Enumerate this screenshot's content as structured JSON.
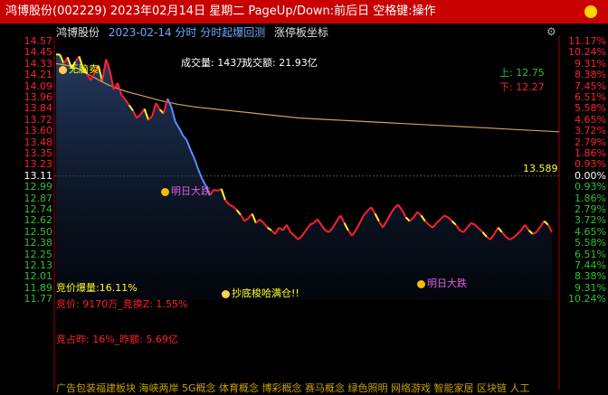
{
  "window": {
    "title": "鸿博股份(002229) 2023年02月14日 星期二 PageUp/Down:前后日 空格键:操作"
  },
  "header": {
    "stock_name": "鸿博股份",
    "info": "2023-02-14 分时 分时起爆回测",
    "mode": "涨停板坐标",
    "settings_icon": "gear-icon"
  },
  "summary": {
    "volume_label": "成交量: 143万",
    "amount_label": "成交额: 21.93亿"
  },
  "range": {
    "up_label": "上: 12.75",
    "down_label": "下: 12.27"
  },
  "left_axis": [
    "14.57",
    "14.45",
    "14.33",
    "14.21",
    "14.09",
    "13.96",
    "13.84",
    "13.72",
    "13.60",
    "13.48",
    "13.35",
    "13.23",
    "13.11",
    "12.99",
    "12.87",
    "12.74",
    "12.62",
    "12.50",
    "12.38",
    "12.25",
    "12.13",
    "12.01",
    "11.89",
    "11.77"
  ],
  "right_axis": [
    "11.17%",
    "10.24%",
    "9.31%",
    "8.38%",
    "7.45%",
    "6.51%",
    "5.58%",
    "4.65%",
    "3.72%",
    "2.79%",
    "1.86%",
    "0.93%",
    "0.00%",
    "0.93%",
    "1.86%",
    "2.79%",
    "3.72%",
    "4.65%",
    "5.58%",
    "6.51%",
    "7.44%",
    "8.38%",
    "9.31%",
    "10.24%"
  ],
  "annotations": {
    "sell_signal": "无脑卖",
    "drop_signal_1": "明日大跌",
    "bottom_signal": "抄底梭哈满仓!!",
    "drop_signal_2": "明日大跌",
    "avg_value": "13.589"
  },
  "stats": {
    "bid_volume": "竞价爆量:16.11%",
    "bid_price": "竞价: 9170万_竞换Z: 1.55%",
    "bid_ratio": "竞占昨: 16%_昨额: 5.69亿"
  },
  "footer": {
    "concepts": "广告包装福建板块 海峡两岸 5G概念 体育概念 博彩概念 赛马概念 绿色照明 网络游戏 智能家居 区块链 人工"
  },
  "colors": {
    "title_bar": "#c80000",
    "rise": "#ff2030",
    "fall": "#30c030",
    "flat": "#ffffff",
    "yellow_line": "#ffff20",
    "avg_line": "#d0a060",
    "blue_line": "#5a8cff",
    "magenta": "#e060e0"
  },
  "chart_data": {
    "type": "line",
    "title": "",
    "xlabel": "",
    "ylabel": "",
    "ylim": [
      11.77,
      14.57
    ],
    "prev_close": 13.11,
    "series": [
      {
        "kind": "price",
        "values": [
          14.43,
          14.43,
          14.33,
          14.4,
          14.28,
          14.35,
          14.41,
          14.28,
          14.22,
          14.15,
          14.23,
          14.31,
          14.14,
          14.38,
          14.25,
          14.05,
          14.12,
          13.99,
          13.94,
          13.88,
          13.82,
          13.74,
          13.78,
          13.84,
          13.72,
          13.76,
          13.9,
          13.83,
          13.79,
          13.95,
          13.86,
          13.7,
          13.63,
          13.55,
          13.5,
          13.39,
          13.3,
          13.18,
          13.08,
          13.0,
          12.9,
          12.96,
          12.95,
          12.97,
          12.85,
          12.8,
          12.78,
          12.74,
          12.69,
          12.62,
          12.65,
          12.7,
          12.6,
          12.64,
          12.6,
          12.55,
          12.52,
          12.48,
          12.55,
          12.52,
          12.58,
          12.5,
          12.46,
          12.42,
          12.46,
          12.52,
          12.58,
          12.6,
          12.64,
          12.58,
          12.52,
          12.5,
          12.55,
          12.62,
          12.68,
          12.6,
          12.52,
          12.46,
          12.52,
          12.6,
          12.68,
          12.73,
          12.77,
          12.7,
          12.62,
          12.55,
          12.62,
          12.7,
          12.76,
          12.8,
          12.74,
          12.66,
          12.62,
          12.66,
          12.72,
          12.68,
          12.62,
          12.58,
          12.55,
          12.6,
          12.64,
          12.68,
          12.66,
          12.62,
          12.58,
          12.52,
          12.5,
          12.55,
          12.6,
          12.58,
          12.54,
          12.5,
          12.45,
          12.42,
          12.48,
          12.55,
          12.5,
          12.45,
          12.42,
          12.44,
          12.48,
          12.52,
          12.58,
          12.52,
          12.48,
          12.5,
          12.56,
          12.62,
          12.58,
          12.5
        ]
      },
      {
        "kind": "average",
        "values": [
          14.33,
          14.3,
          14.2,
          14.1,
          14.03,
          13.98,
          13.93,
          13.89,
          13.86,
          13.84,
          13.82,
          13.8,
          13.78,
          13.76,
          13.74,
          13.73,
          13.72,
          13.71,
          13.7,
          13.69,
          13.68,
          13.67,
          13.66,
          13.65,
          13.64,
          13.63,
          13.62,
          13.61,
          13.6,
          13.59
        ]
      }
    ]
  }
}
